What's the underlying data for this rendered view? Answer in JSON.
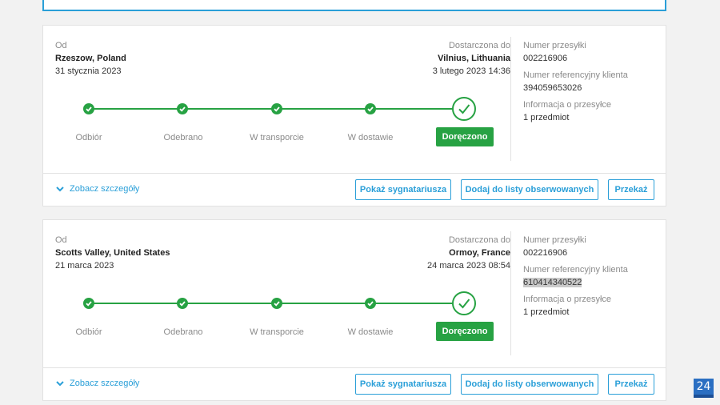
{
  "shipments": [
    {
      "from_label": "Od",
      "from_city": "Rzeszow, Poland",
      "from_date": "31 stycznia 2023",
      "to_label": "Dostarczona do",
      "to_city": "Vilnius, Lithuania",
      "to_date": "3 lutego 2023 14:36",
      "tracking_label": "Numer przesyłki",
      "tracking_number": "002216906",
      "ref_label": "Numer referencyjny klienta",
      "ref_number": "394059653026",
      "info_label": "Informacja o przesyłce",
      "info_value": "1 przedmiot",
      "steps": [
        "Odbiór",
        "Odebrano",
        "W transporcie",
        "W dostawie",
        "Doręczono"
      ],
      "details_link": "Zobacz szczegóły",
      "btn_signatory": "Pokaż sygnatariusza",
      "btn_watchlist": "Dodaj do listy obserwowanych",
      "btn_forward": "Przekaż"
    },
    {
      "from_label": "Od",
      "from_city": "Scotts Valley, United States",
      "from_date": "21 marca 2023",
      "to_label": "Dostarczona do",
      "to_city": "Ormoy, France",
      "to_date": "24 marca 2023 08:54",
      "tracking_label": "Numer przesyłki",
      "tracking_number": "002216906",
      "ref_label": "Numer referencyjny klienta",
      "ref_number": "610414340522",
      "info_label": "Informacja o przesyłce",
      "info_value": "1 przedmiot",
      "steps": [
        "Odbiór",
        "Odebrano",
        "W transporcie",
        "W dostawie",
        "Doręczono"
      ],
      "details_link": "Zobacz szczegóły",
      "btn_signatory": "Pokaż sygnatariusza",
      "btn_watchlist": "Dodaj do listy obserwowanych",
      "btn_forward": "Przekaż"
    }
  ],
  "badge": "24",
  "colors": {
    "accent": "#2a9fd8",
    "success": "#27a243"
  },
  "icons": [
    "check-icon",
    "chevron-down-icon"
  ]
}
